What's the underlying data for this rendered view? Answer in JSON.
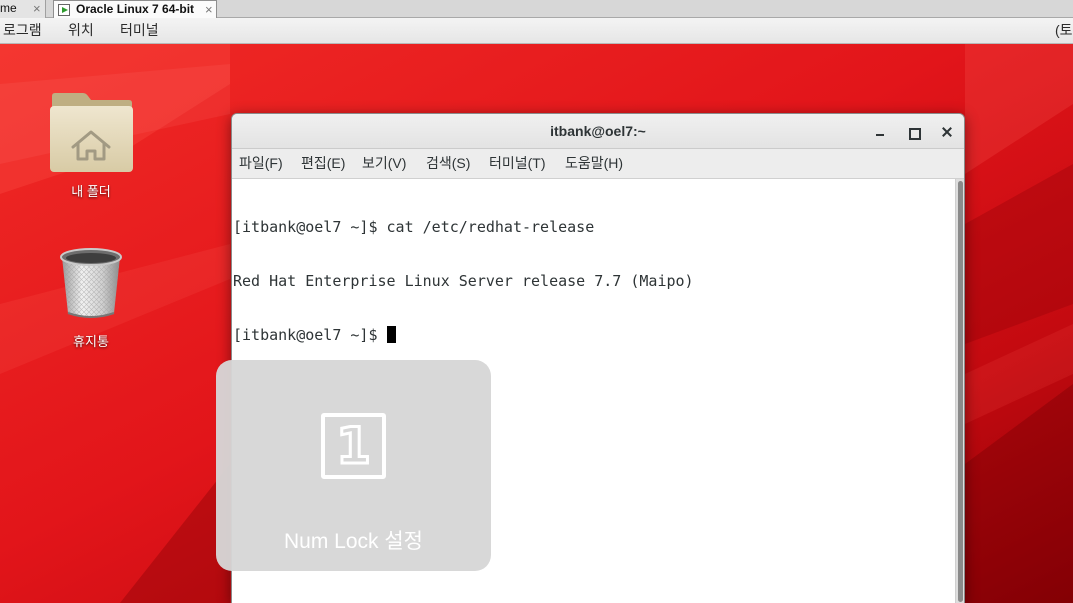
{
  "tabs": [
    {
      "label": "me",
      "close": "×"
    },
    {
      "label": "Oracle Linux 7 64-bit",
      "close": "×",
      "icon": "vm-icon"
    }
  ],
  "topbar": {
    "applications": "로그램",
    "places": "위치",
    "terminal": "터미널",
    "clock": "(토"
  },
  "desktop": {
    "icons": [
      {
        "label": "내 폴더",
        "icon": "home-folder-icon"
      },
      {
        "label": "휴지통",
        "icon": "trash-icon"
      }
    ]
  },
  "terminal": {
    "title": "itbank@oel7:~",
    "menu": [
      "파일(F)",
      "편집(E)",
      "보기(V)",
      "검색(S)",
      "터미널(T)",
      "도움말(H)"
    ],
    "lines": [
      "[itbank@oel7 ~]$ cat /etc/redhat-release",
      "Red Hat Enterprise Linux Server release 7.7 (Maipo)",
      "[itbank@oel7 ~]$ "
    ]
  },
  "osd": {
    "number": "1",
    "text": "Num Lock 설정",
    "icon": "numlock-icon"
  },
  "colors": {
    "desktop": "#e3161a",
    "terminal_bg": "#ffffff",
    "terminal_fg": "#2e3436",
    "osd_bg": "#d6d6d6"
  }
}
